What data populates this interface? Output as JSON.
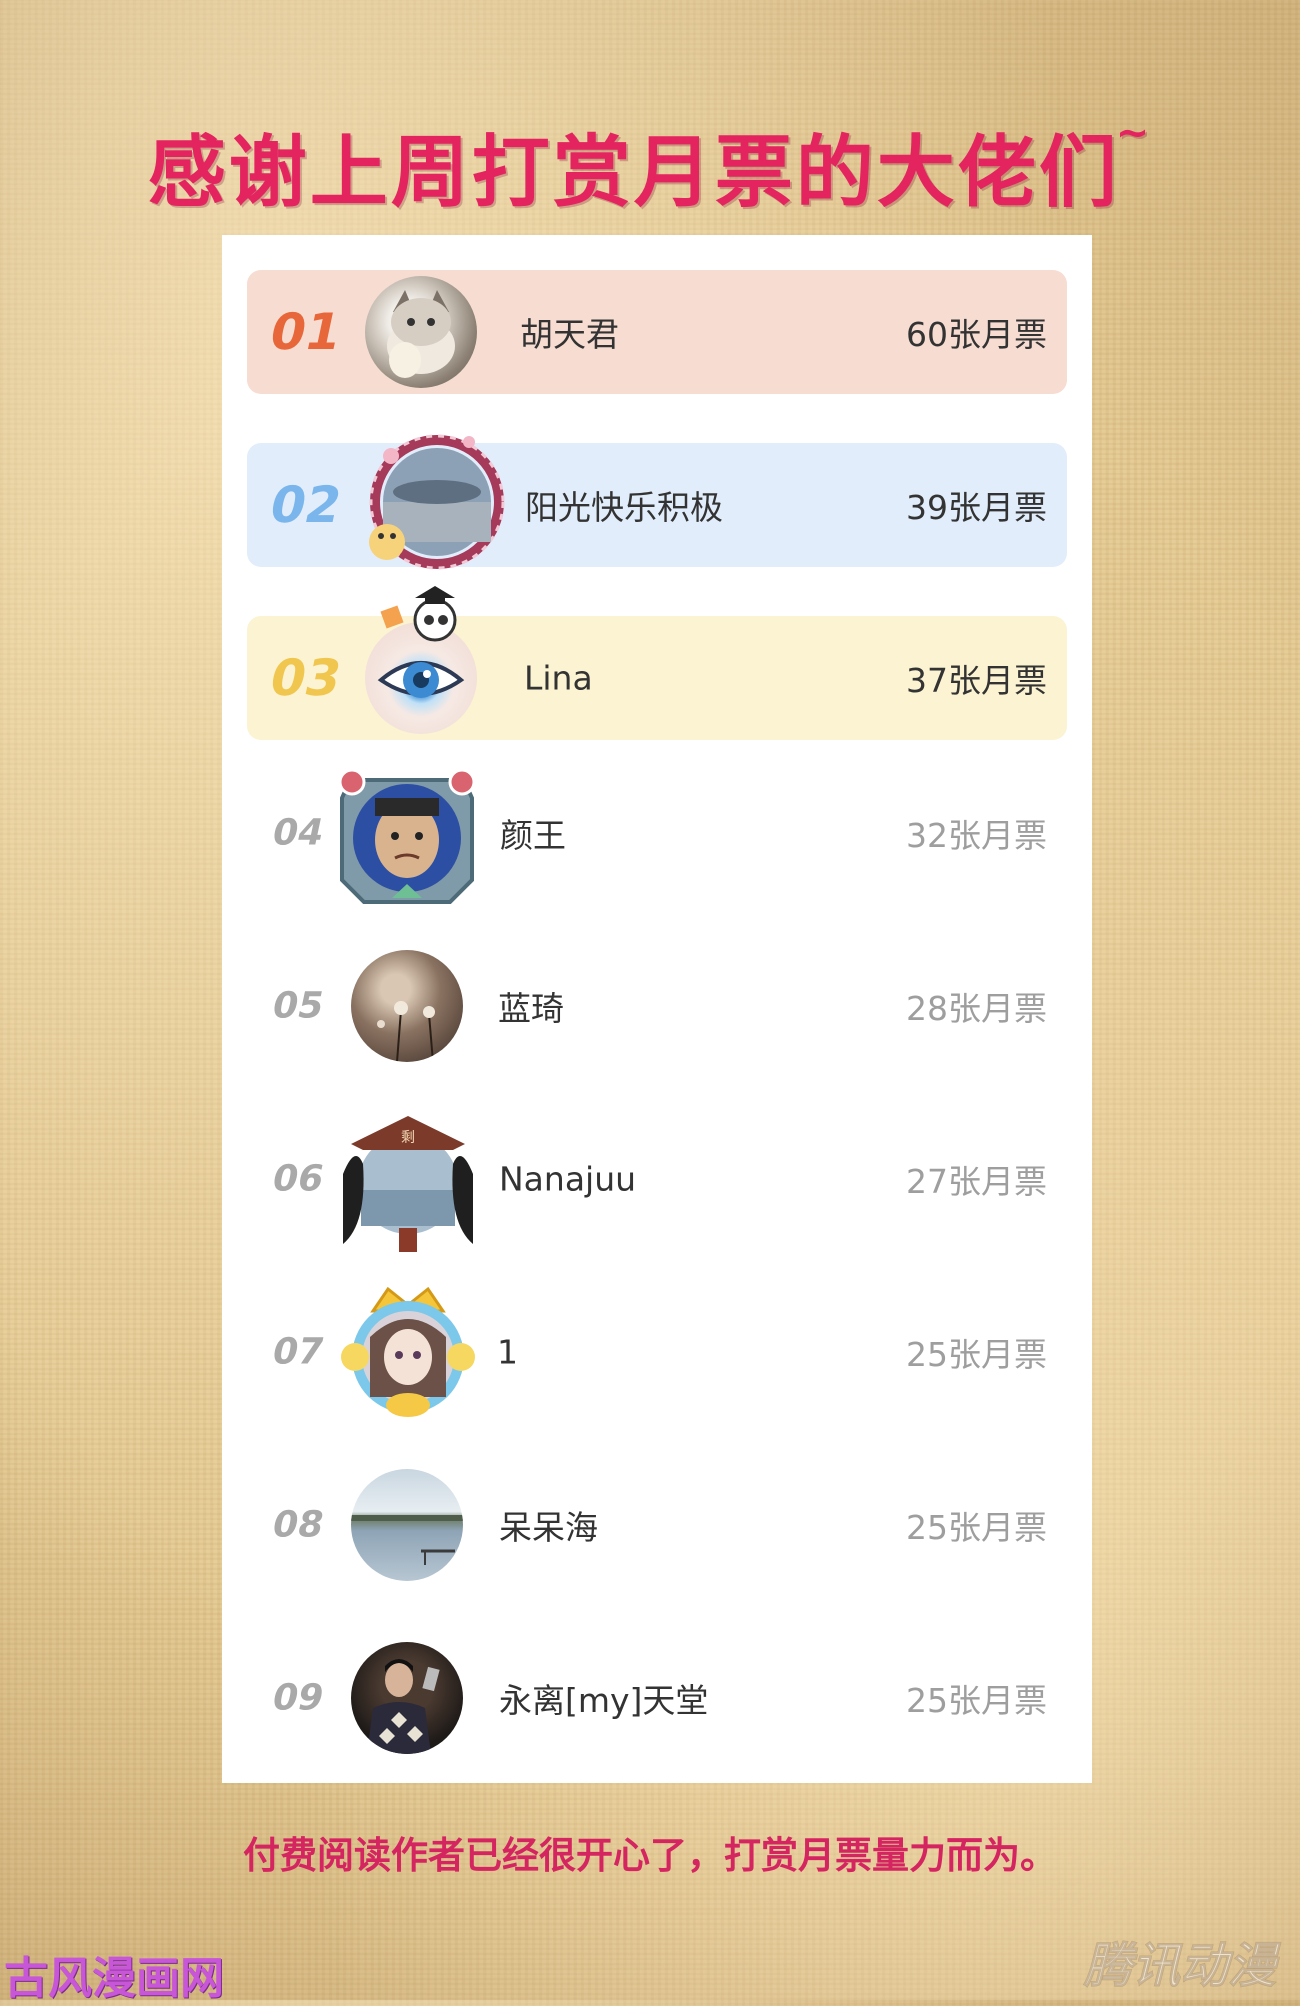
{
  "header": {
    "title": "感谢上周打赏月票的大佬们",
    "tilde": "~"
  },
  "leaderboard": [
    {
      "rank": "01",
      "name": "胡天君",
      "votes": "60张月票",
      "bg": "#f7dcd2",
      "rank_color": "#e8673a"
    },
    {
      "rank": "02",
      "name": "阳光快乐积极",
      "votes": "39张月票",
      "bg": "#e2edfb",
      "rank_color": "#7ab6ec"
    },
    {
      "rank": "03",
      "name": "Lina",
      "votes": "37张月票",
      "bg": "#fbf3d1",
      "rank_color": "#f0c64e"
    },
    {
      "rank": "04",
      "name": "颜王",
      "votes": "32张月票"
    },
    {
      "rank": "05",
      "name": "蓝琦",
      "votes": "28张月票"
    },
    {
      "rank": "06",
      "name": "Nanajuu",
      "votes": "27张月票"
    },
    {
      "rank": "07",
      "name": "1",
      "votes": "25张月票"
    },
    {
      "rank": "08",
      "name": "呆呆海",
      "votes": "25张月票"
    },
    {
      "rank": "09",
      "name": "永离[my]天堂",
      "votes": "25张月票"
    }
  ],
  "footer": {
    "text": "付费阅读作者已经很开心了，打赏月票量力而为。"
  },
  "watermarks": {
    "left": "古风漫画网",
    "right": "腾讯动漫"
  }
}
